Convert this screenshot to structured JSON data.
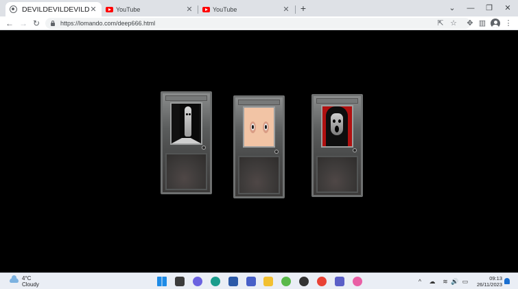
{
  "browser": {
    "tabs": [
      {
        "label": "DEVILDEVILDEVILDE",
        "favicon": "globe-icon",
        "active": true
      },
      {
        "label": "YouTube",
        "favicon": "youtube-icon",
        "active": false
      },
      {
        "label": "YouTube",
        "favicon": "youtube-icon",
        "active": false
      }
    ],
    "tab_close_glyph": "✕",
    "new_tab_glyph": "+",
    "tab_search_glyph": "⌄",
    "window_controls": {
      "minimize": "—",
      "maximize": "❐",
      "close": "✕"
    },
    "nav": {
      "back": "←",
      "forward": "→",
      "reload": "↻"
    },
    "url": "https://lomando.com/deep666.html",
    "toolbar_icons": {
      "share": "⇱",
      "bookmark": "☆",
      "extensions": "✥",
      "sidepanel": "▥",
      "menu": "⋮"
    }
  },
  "page": {
    "background": "#000000",
    "doors": [
      {
        "name": "door-pale-girl",
        "window_color": "#111111"
      },
      {
        "name": "door-eyes",
        "window_color": "#f2c4a5"
      },
      {
        "name": "door-screamer",
        "window_color": "#b01010"
      }
    ]
  },
  "taskbar": {
    "weather": {
      "temp": "4°C",
      "condition": "Cloudy"
    },
    "apps": [
      {
        "name": "windows-start-icon",
        "color": "#1e8be6"
      },
      {
        "name": "file-explorer-icon",
        "color": "#3c3c3c"
      },
      {
        "name": "chat-icon",
        "color": "#6b62e0"
      },
      {
        "name": "edge-icon",
        "color": "#1a9c8c"
      },
      {
        "name": "store-icon",
        "color": "#2d5aa8"
      },
      {
        "name": "editor-icon",
        "color": "#4860c8"
      },
      {
        "name": "folder-icon",
        "color": "#f2c031"
      },
      {
        "name": "photos-icon",
        "color": "#59b94a"
      },
      {
        "name": "scream-app-icon",
        "color": "#333333"
      },
      {
        "name": "chrome-icon",
        "color": "#e94235"
      },
      {
        "name": "teams-icon",
        "color": "#5b5fc7"
      },
      {
        "name": "paint-icon",
        "color": "#e95fa5"
      }
    ],
    "tray": {
      "chevron": "^",
      "cloud": "☁",
      "wifi": "≋",
      "volume": "🔊",
      "battery": "▭"
    },
    "time": "09:13",
    "date": "26/11/2023"
  }
}
